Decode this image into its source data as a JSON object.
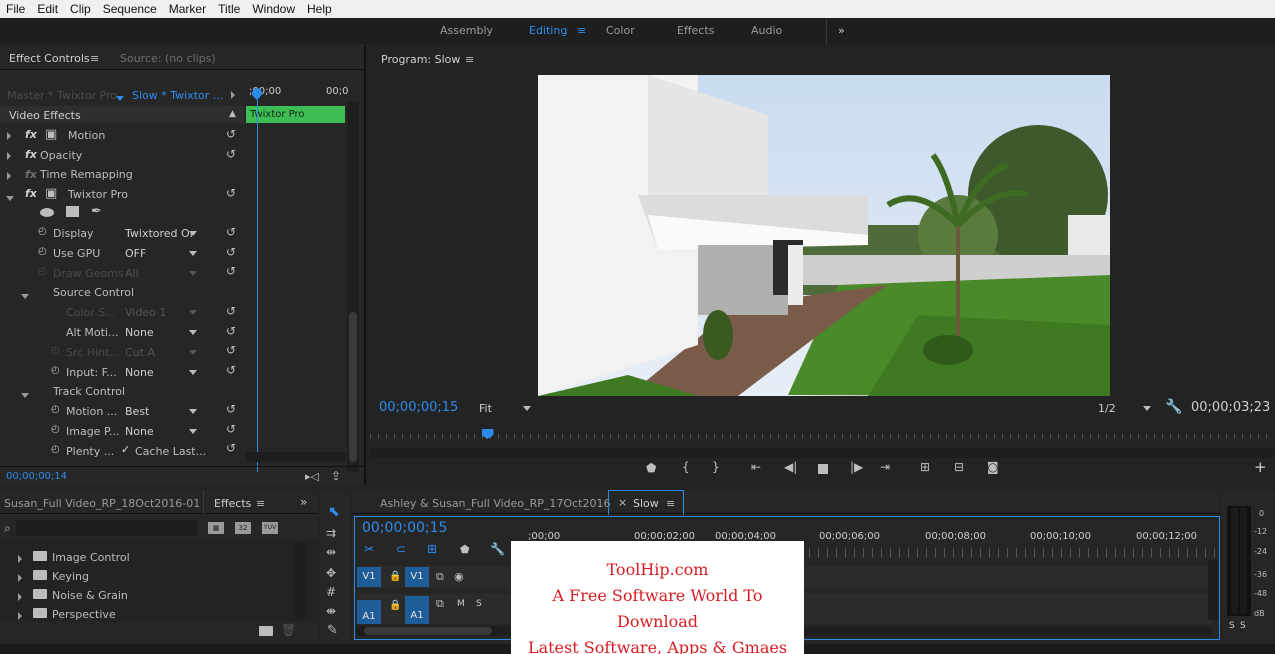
{
  "menu": [
    "File",
    "Edit",
    "Clip",
    "Sequence",
    "Marker",
    "Title",
    "Window",
    "Help"
  ],
  "workspaces": [
    "Assembly",
    "Editing",
    "Color",
    "Effects",
    "Audio"
  ],
  "workspace_active": "Editing",
  "more_workspaces": "»",
  "effect_controls": {
    "tab_label": "Effect Controls",
    "source_tab": "Source: (no clips)",
    "master_label": "Master * Twixtor Pro",
    "clip_label": "Slow * Twixtor ...",
    "ruler_start": ";00;00",
    "ruler_end": "00;0",
    "clip_bar": "Twixtor Pro",
    "section": "Video Effects",
    "effects": [
      {
        "fx": "fx",
        "label": "Motion"
      },
      {
        "fx": "fx",
        "label": "Opacity"
      },
      {
        "fx": "fx",
        "label": "Time Remapping"
      },
      {
        "fx": "fx",
        "label": "Twixtor Pro"
      }
    ],
    "params": [
      {
        "label": "Display",
        "value": "Twixtored Or"
      },
      {
        "label": "Use GPU",
        "value": "OFF"
      },
      {
        "label": "Draw Geoms",
        "value": "All"
      },
      {
        "label": "Source Control",
        "value": ""
      },
      {
        "label": "Color S...",
        "value": "Video 1"
      },
      {
        "label": "Alt Moti...",
        "value": "None"
      },
      {
        "label": "Src Hint...",
        "value": "Cut A"
      },
      {
        "label": "Input: F...",
        "value": "None"
      },
      {
        "label": "Track Control",
        "value": ""
      },
      {
        "label": "Motion ...",
        "value": "Best"
      },
      {
        "label": "Image P...",
        "value": "None"
      },
      {
        "label": "Plenty ...",
        "value": "Cache Last..."
      }
    ],
    "checkmark": "✓",
    "timecode": "00;00;00;14"
  },
  "program": {
    "title": "Program: Slow",
    "timecode": "00;00;00;15",
    "fit": "Fit",
    "resolution": "1/2",
    "duration": "00;00;03;23",
    "playhead_fraction": 0.13
  },
  "project": {
    "tab1": "Susan_Full Video_RP_18Oct2016-01",
    "tab2": "Effects",
    "items": [
      "Image Control",
      "Keying",
      "Noise & Grain",
      "Perspective"
    ],
    "icon_labels": [
      "32",
      "YUV"
    ]
  },
  "timeline": {
    "tab1": "Ashley & Susan_Full Video_RP_17Oct2016",
    "tab2": "Slow",
    "timecode": "00;00;00;15",
    "ruler": [
      ";00;00",
      "00;00;02;00",
      "00;00;04;00",
      "00;00;06;00",
      "00;00;08;00",
      "00;00;10;00",
      "00;00;12;00"
    ],
    "tracks": [
      {
        "src": "V1",
        "dst": "V1"
      },
      {
        "src": "A1",
        "dst": "A1",
        "m": "M",
        "s": "S"
      }
    ]
  },
  "meters": {
    "labels": [
      "0",
      "-12",
      "-24",
      "-36",
      "-48",
      "dB"
    ],
    "bottom": [
      "S",
      "S"
    ]
  },
  "watermark": {
    "line1": "ToolHip.com",
    "line2": "A Free Software World To Download",
    "line3": "Latest Software, Apps & Gmaes"
  }
}
